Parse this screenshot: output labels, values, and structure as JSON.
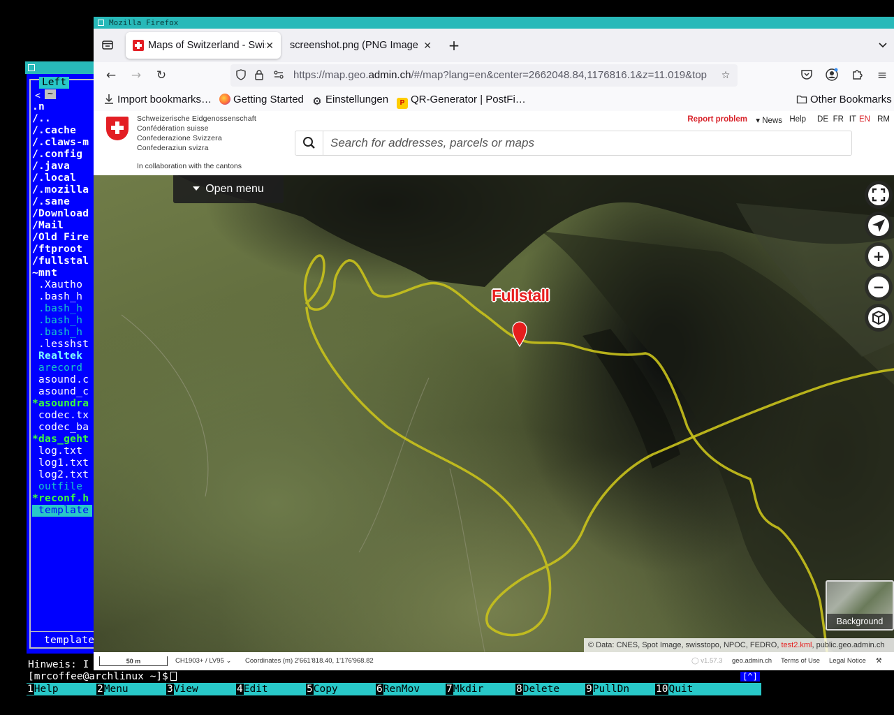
{
  "terminal": {
    "panel_label": "Left",
    "path_tilde": "~",
    "entries": [
      {
        "text": ".n",
        "style": "link"
      },
      {
        "text": "/..",
        "style": "link"
      },
      {
        "text": "/.cache",
        "style": "link"
      },
      {
        "text": "/.claws-m",
        "style": "link"
      },
      {
        "text": "/.config",
        "style": "link"
      },
      {
        "text": "/.java",
        "style": "link"
      },
      {
        "text": "/.local",
        "style": "link"
      },
      {
        "text": "/.mozilla",
        "style": "link"
      },
      {
        "text": "/.sane",
        "style": "link"
      },
      {
        "text": "/Download",
        "style": "link"
      },
      {
        "text": "/Mail",
        "style": "link"
      },
      {
        "text": "/Old Fire",
        "style": "link"
      },
      {
        "text": "/ftproot",
        "style": "link"
      },
      {
        "text": "/fullstal",
        "style": "link"
      },
      {
        "text": "~mnt",
        "style": "link"
      },
      {
        "text": " .Xautho",
        "style": "reg"
      },
      {
        "text": " .bash_h",
        "style": "reg"
      },
      {
        "text": " .bash_h",
        "style": "dim"
      },
      {
        "text": " .bash_h",
        "style": "dim"
      },
      {
        "text": " .bash_h",
        "style": "dim"
      },
      {
        "text": " .lesshst",
        "style": "reg"
      },
      {
        "text": " Realtek",
        "style": "cyan"
      },
      {
        "text": " arecord",
        "style": "dim"
      },
      {
        "text": " asound.c",
        "style": "reg"
      },
      {
        "text": " asound_c",
        "style": "reg"
      },
      {
        "text": "*asoundra",
        "style": "exec"
      },
      {
        "text": " codec.tx",
        "style": "reg"
      },
      {
        "text": " codec_ba",
        "style": "reg"
      },
      {
        "text": "*das_geht",
        "style": "exec"
      },
      {
        "text": " log.txt",
        "style": "reg"
      },
      {
        "text": " log1.txt",
        "style": "reg"
      },
      {
        "text": " log2.txt",
        "style": "reg"
      },
      {
        "text": " outfile",
        "style": "dim"
      },
      {
        "text": "*reconf.h",
        "style": "exec"
      },
      {
        "text": " template",
        "style": "sel"
      }
    ],
    "status_line": " template",
    "hint": "Hinweis: I",
    "prompt": "[mrcoffee@archlinux ~]$",
    "caret_button": "[^]",
    "fkeys": [
      {
        "num": "1",
        "label": "Help"
      },
      {
        "num": "2",
        "label": "Menu"
      },
      {
        "num": "3",
        "label": "View"
      },
      {
        "num": "4",
        "label": "Edit"
      },
      {
        "num": "5",
        "label": "Copy"
      },
      {
        "num": "6",
        "label": "RenMov"
      },
      {
        "num": "7",
        "label": "Mkdir"
      },
      {
        "num": "8",
        "label": "Delete"
      },
      {
        "num": "9",
        "label": "PullDn"
      },
      {
        "num": "10",
        "label": "Quit"
      }
    ]
  },
  "browser": {
    "window_title": "Mozilla Firefox",
    "tabs": [
      {
        "title": "Maps of Switzerland - Swiss",
        "active": true
      },
      {
        "title": "screenshot.png (PNG Image,",
        "active": false
      }
    ],
    "url_prefix": "https://map.geo.",
    "url_domain": "admin.ch",
    "url_rest": "/#/map?lang=en&center=2662048.84,1176816.1&z=11.019&top",
    "bookmarks": [
      {
        "label": "Import bookmarks…",
        "icon": "import-icon"
      },
      {
        "label": "Getting Started",
        "icon": "firefox-icon"
      },
      {
        "label": "Einstellungen",
        "icon": "gear-icon"
      },
      {
        "label": "QR-Generator | PostFi…",
        "icon": "postfinance-icon"
      }
    ],
    "other_bookmarks": "Other Bookmarks"
  },
  "geo": {
    "federation_names": [
      "Schweizerische Eidgenossenschaft",
      "Confédération suisse",
      "Confederazione Svizzera",
      "Confederaziun svizra"
    ],
    "collab": "In collaboration with the cantons",
    "report_problem": "Report problem",
    "news": "News",
    "help": "Help",
    "languages": [
      "DE",
      "FR",
      "IT",
      "EN",
      "RM"
    ],
    "active_language": "EN",
    "search_placeholder": "Search for addresses, parcels or maps",
    "open_menu": "Open menu",
    "place_label": "Fullstall",
    "background_label": "Background",
    "attribution": {
      "prefix": "© Data:",
      "sources": "CNES, Spot Image, swisstopo, NPOC, FEDRO,",
      "kml": "test2.kml",
      "suffix": ", public.geo.admin.ch"
    },
    "footer": {
      "scale": "50 m",
      "projection": "CH1903+ / LV95",
      "coordinates": "Coordinates (m) 2'661'818.40, 1'176'968.82",
      "version": "v1.57.3",
      "site": "geo.admin.ch",
      "terms": "Terms of Use",
      "legal": "Legal Notice"
    },
    "colors": {
      "track": "#c9c21c",
      "marker": "#e61e1e",
      "accent_red": "#e31e24"
    }
  }
}
